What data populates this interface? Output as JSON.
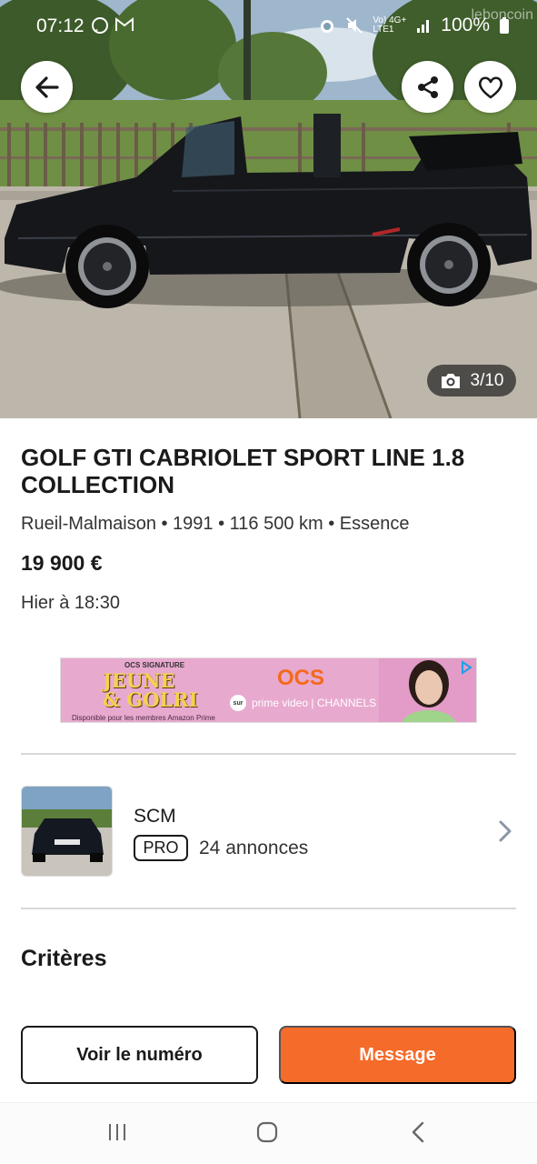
{
  "status_bar": {
    "time": "07:12",
    "network": "Vo) 4G+",
    "network_sub": "LTE1",
    "battery": "100%",
    "watermark": "leboncoin",
    "icons": [
      "whatsapp-icon",
      "gmail-icon",
      "alarm-icon",
      "mute-icon",
      "signal-icon",
      "battery-icon"
    ]
  },
  "photo": {
    "counter": "3/10",
    "counter_icon": "camera-icon"
  },
  "actions": {
    "back_icon": "arrow-left-icon",
    "share_icon": "share-icon",
    "favorite_icon": "heart-icon"
  },
  "listing": {
    "title": "GOLF GTI CABRIOLET SPORT LINE 1.8 COLLECTION",
    "specs": "Rueil-Malmaison • 1991 • 116 500 km • Essence",
    "price": "19 900 €",
    "date": "Hier à 18:30"
  },
  "ad": {
    "brand_small": "OCS SIGNATURE",
    "headline_1": "JEUNE",
    "headline_2": "& GOLRI",
    "disclaimer": "Disponible pour les membres Amazon Prime",
    "brand": "OCS",
    "sur": "sur",
    "partner": "prime video | CHANNELS"
  },
  "seller": {
    "name": "SCM",
    "badge": "PRO",
    "ads_count": "24 annonces"
  },
  "sections": {
    "criteria": "Critères"
  },
  "buttons": {
    "call": "Voir le numéro",
    "message": "Message"
  },
  "colors": {
    "accent": "#f56b2a",
    "text": "#1a1a1a",
    "divider": "#d8d8d8"
  }
}
